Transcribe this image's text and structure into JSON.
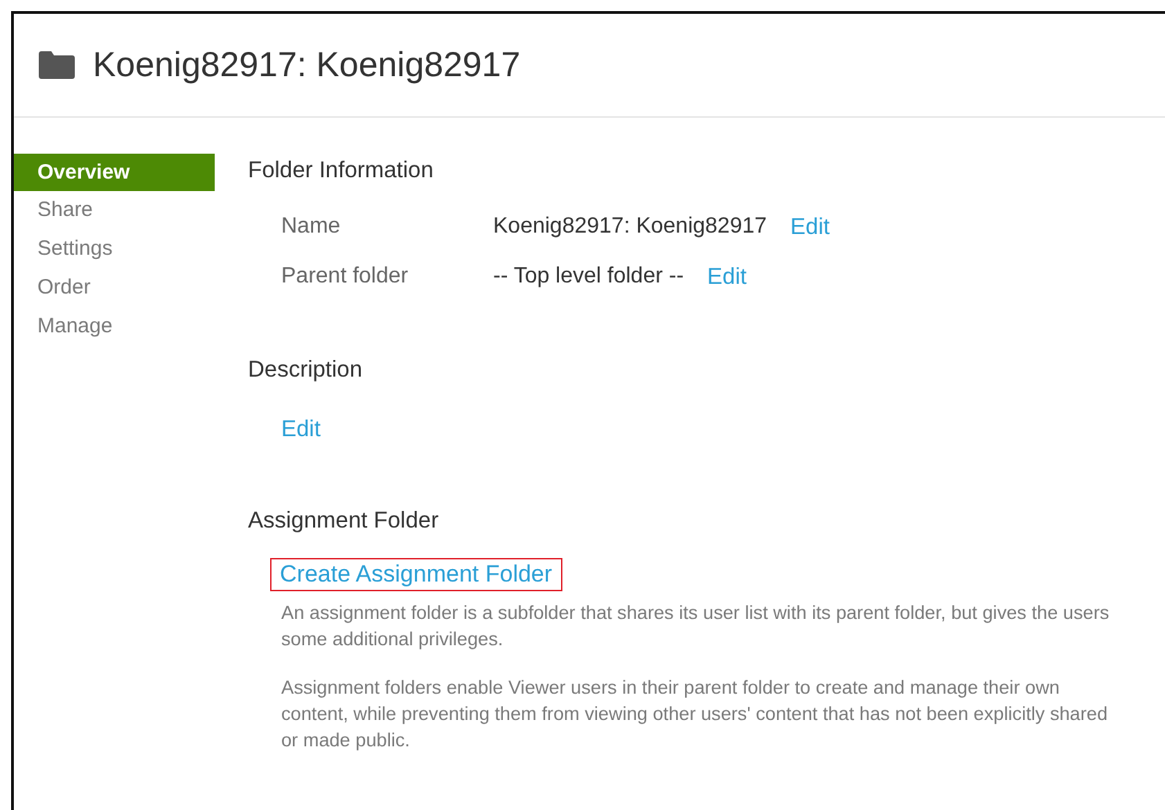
{
  "header": {
    "title": "Koenig82917: Koenig82917"
  },
  "sidebar": {
    "items": [
      {
        "label": "Overview",
        "selected": true
      },
      {
        "label": "Share",
        "selected": false
      },
      {
        "label": "Settings",
        "selected": false
      },
      {
        "label": "Order",
        "selected": false
      },
      {
        "label": "Manage",
        "selected": false
      }
    ]
  },
  "folder_information": {
    "heading": "Folder Information",
    "rows": [
      {
        "label": "Name",
        "value": "Koenig82917: Koenig82917",
        "action": "Edit"
      },
      {
        "label": "Parent folder",
        "value": "-- Top level folder --",
        "action": "Edit"
      }
    ]
  },
  "description": {
    "heading": "Description",
    "action": "Edit"
  },
  "assignment_folder": {
    "heading": "Assignment Folder",
    "link": "Create Assignment Folder",
    "highlighted": true,
    "paragraphs": [
      "An assignment folder is a subfolder that shares its user list with its parent folder, but gives the users some additional privileges.",
      "Assignment folders enable Viewer users in their parent folder to create and manage their own content, while preventing them from viewing other users' content that has not been explicitly shared or made public."
    ]
  }
}
